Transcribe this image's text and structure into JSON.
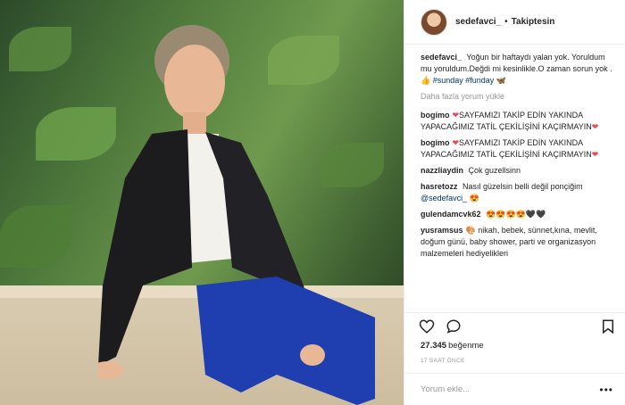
{
  "post": {
    "username": "sedefavci_",
    "separator": "•",
    "follow_status": "Takiptesin"
  },
  "caption": {
    "user": "sedefavci_",
    "text": "Yoğun bir haftaydı yalan yok. Yoruldum mu yoruldum.Değdi mi kesinlikle.O zaman sorun yok . 👍",
    "tag1": "#sunday",
    "tag2": "#funday",
    "emoji": "🦋"
  },
  "load_more": "Daha fazla yorum yükle",
  "comments": [
    {
      "user": "bogimo",
      "heart": "❤",
      "text": "SAYFAMIZI TAKİP EDİN YAKINDA YAPACAĞIMIZ TATİL ÇEKİLİŞİNİ KAÇIRMAYIN",
      "tail": "❤"
    },
    {
      "user": "bogimo",
      "heart": "❤",
      "text": "SAYFAMIZI TAKİP EDİN YAKINDA YAPACAĞIMIZ TATİL ÇEKİLİŞİNİ KAÇIRMAYIN",
      "tail": "❤"
    },
    {
      "user": "nazzliaydin",
      "text": "Çok guzellsinn"
    },
    {
      "user": "hasretozz",
      "text": "Nasıl güzelsin belli değil ponçiğim",
      "mention": "@sedefavci_",
      "emoji": "😍"
    },
    {
      "user": "gulendamcvk62",
      "text": "😍😍😍😍🖤🖤"
    },
    {
      "user": "yusramsus",
      "emoji": "🎨",
      "text": "nikah, bebek, sünnet,kına, mevlit, doğum günü, baby shower, parti ve organizasyon malzemeleri hediyelikleri"
    }
  ],
  "likes": {
    "count": "27.345",
    "label": "beğenme"
  },
  "time_ago": "17 SAAT ÖNCE",
  "comment_placeholder": "Yorum ekle...",
  "more_icon": "•••",
  "icons": [
    "heart-icon",
    "comment-icon",
    "bookmark-icon",
    "more-options-icon"
  ],
  "colors": {
    "link": "#003569",
    "muted": "#999999",
    "text": "#262626",
    "border": "#efefef"
  }
}
